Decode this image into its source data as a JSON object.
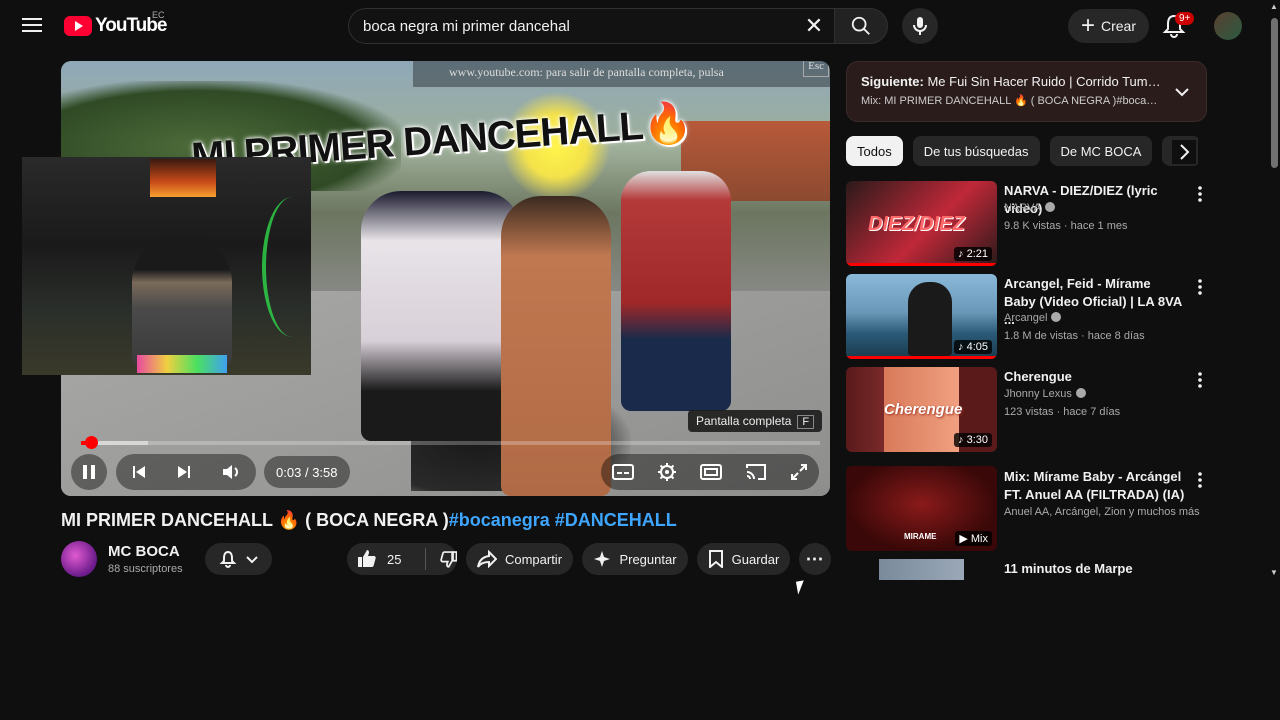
{
  "header": {
    "logo_text": "YouTube",
    "country_code": "EC",
    "search_value": "boca negra mi primer dancehal",
    "create_label": "Crear",
    "notifications_badge": "9+"
  },
  "player": {
    "fullscreen_notice": "www.youtube.com: para salir de pantalla completa, pulsa",
    "fullscreen_notice_key": "Esc",
    "overlay_title": "MI PRIMER DANCEHALL🔥",
    "fullscreen_tip": "Pantalla completa",
    "fullscreen_tip_key": "F",
    "time_current": "0:03",
    "time_separator": "/",
    "time_total": "3:58",
    "progress_played": 0.013,
    "progress_loaded": 0.09
  },
  "video": {
    "title": "MI PRIMER DANCEHALL 🔥 ( BOCA NEGRA )",
    "hashtags": "#bocanegra #DANCEHALL",
    "channel_name": "MC BOCA",
    "subscribers": "88 suscriptores",
    "likes": "25",
    "share_label": "Compartir",
    "ask_label": "Preguntar",
    "save_label": "Guardar"
  },
  "up_next": {
    "prefix": "Siguiente:",
    "title": "Me Fui Sin Hacer Ruido | Corrido Tumba...",
    "mix_line": "Mix: MI PRIMER DANCEHALL 🔥 ( BOCA NEGRA )#bocanegr..."
  },
  "chips": [
    "Todos",
    "De tus búsquedas",
    "De MC BOCA",
    "Re"
  ],
  "recommendations": [
    {
      "title": "NARVA - DIEZ/DIEZ (lyric video)",
      "channel": "NARVA",
      "verified": true,
      "meta": "9.8 K vistas · hace 1 mes",
      "duration": "2:21",
      "thumb_text": "DIEZ/DIEZ"
    },
    {
      "title": "Arcangel, Feid - Mírame Baby (Video Oficial) | LA 8VA ...",
      "channel": "Arcangel",
      "verified": true,
      "meta": "1.8 M de vistas · hace 8 días",
      "duration": "4:05",
      "thumb_text": ""
    },
    {
      "title": "Cherengue",
      "channel": "Jhonny Lexus",
      "verified": true,
      "meta": "123 vistas · hace 7 días",
      "duration": "3:30",
      "thumb_text": "Cherengue"
    },
    {
      "title": "Mix: Mírame Baby - Arcángel FT. Anuel AA (FILTRADA) (IA)",
      "channel": "Anuel AA, Arcángel, Zion y muchos más",
      "verified": false,
      "meta": "",
      "duration": "Mix",
      "thumb_text": "MIRAME"
    },
    {
      "title": "11 minutos de Marpe",
      "channel": "",
      "verified": false,
      "meta": "",
      "duration": "",
      "thumb_text": ""
    }
  ]
}
